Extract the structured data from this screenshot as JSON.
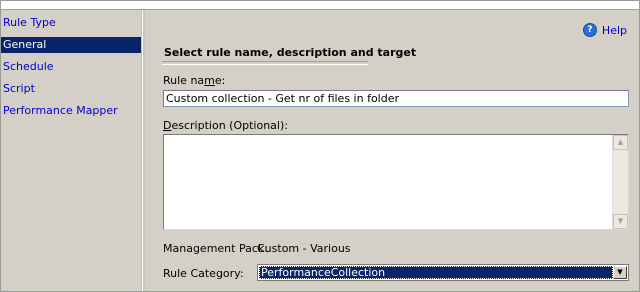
{
  "sidebar": {
    "items": [
      {
        "label": "Rule Type"
      },
      {
        "label": "General"
      },
      {
        "label": "Schedule"
      },
      {
        "label": "Script"
      },
      {
        "label": "Performance Mapper"
      }
    ]
  },
  "help": {
    "label": "Help",
    "icon": "help-icon"
  },
  "section": {
    "title": "Select rule name, description and target"
  },
  "rule_name": {
    "label_pre": "Rule na",
    "label_accel": "m",
    "label_post": "e:",
    "value": "Custom collection - Get nr of files in folder"
  },
  "description": {
    "label_pre": "",
    "label_accel": "D",
    "label_post": "escription (Optional):",
    "value": ""
  },
  "management_pack": {
    "label": "Management Pack:",
    "value": "Custom - Various"
  },
  "rule_category": {
    "label": "Rule Category:",
    "value": "PerformanceCollection"
  },
  "colors": {
    "selection": "#0a246a",
    "link": "#0000cc",
    "panel": "#d4d0c8"
  }
}
